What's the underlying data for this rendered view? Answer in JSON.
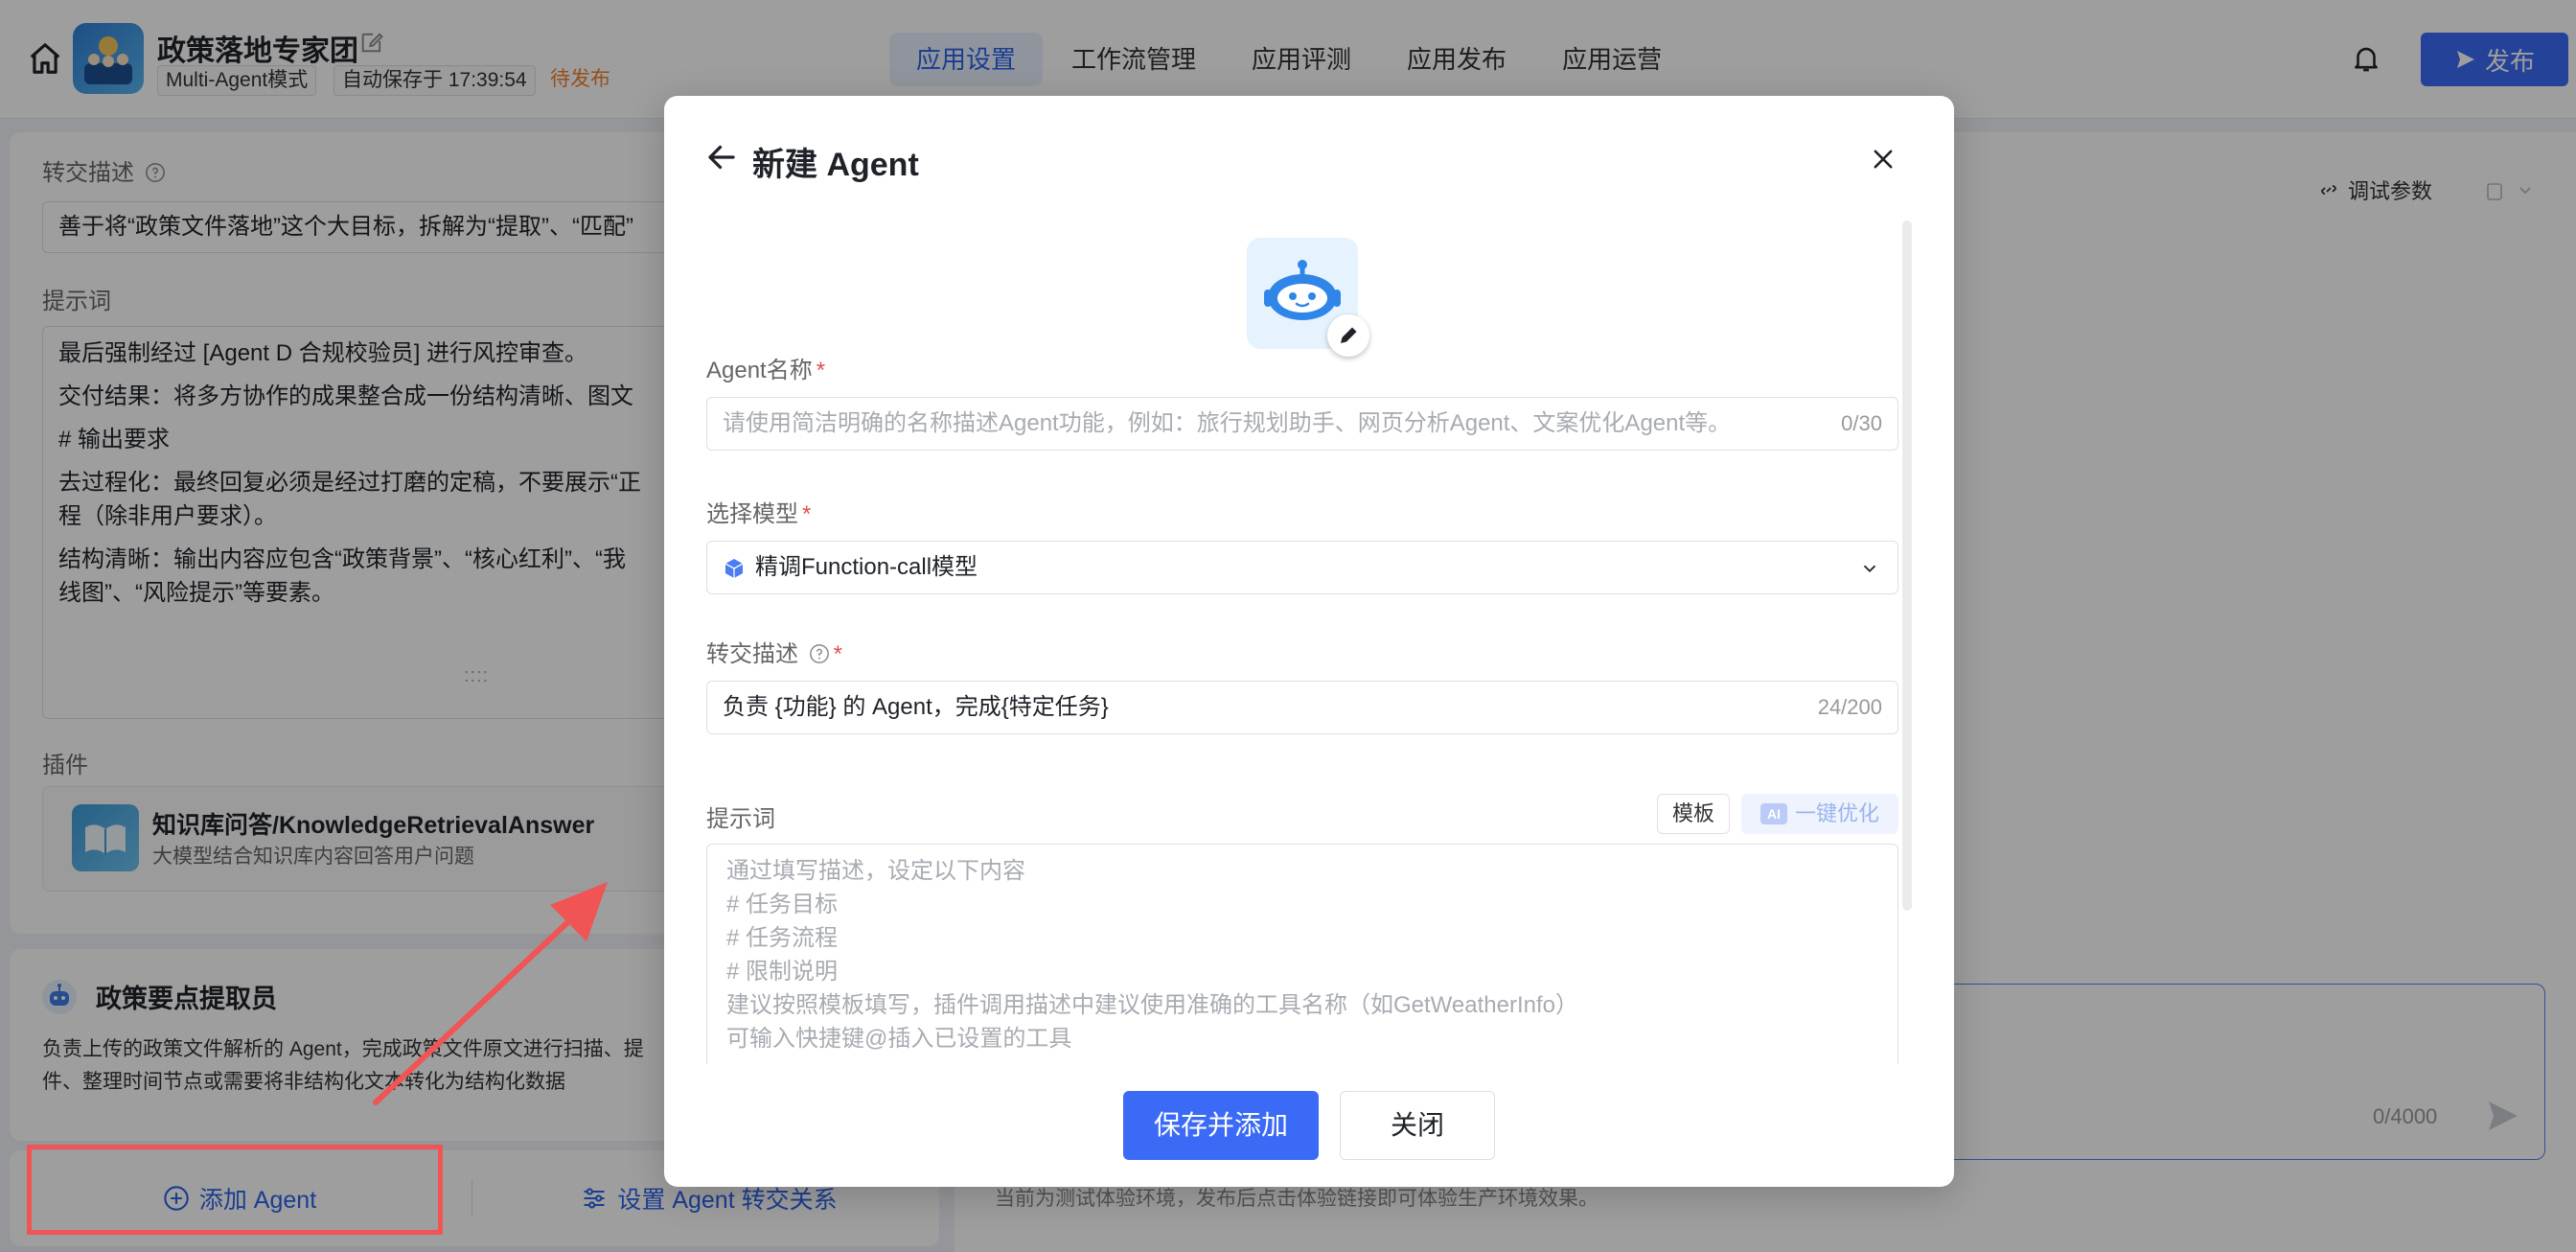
{
  "header": {
    "app_title": "政策落地专家团",
    "mode_tag": "Multi-Agent模式",
    "autosave": "自动保存于 17:39:54",
    "status": "待发布",
    "tabs": [
      {
        "label": "应用设置",
        "active": true
      },
      {
        "label": "工作流管理",
        "active": false
      },
      {
        "label": "应用评测",
        "active": false
      },
      {
        "label": "应用发布",
        "active": false
      },
      {
        "label": "应用运营",
        "active": false
      }
    ],
    "publish_label": "发布"
  },
  "left": {
    "handoff_label": "转交描述",
    "handoff_value": "善于将“政策文件落地”这个大目标，拆解为“提取”、“匹配”",
    "prompt_label": "提示词",
    "prompt_lines": [
      "最后强制经过 [Agent D 合规校验员] 进行风控审查。",
      "交付结果：将多方协作的成果整合成一份结构清晰、图文",
      "# 输出要求",
      "去过程化：最终回复必须是经过打磨的定稿，不要展示“正\n程（除非用户要求）。",
      "结构清晰：输出内容应包含“政策背景”、“核心红利”、“我\n线图”、“风险提示”等要素。"
    ],
    "resize_handle": "::::",
    "plugin_label": "插件",
    "plugin_name": "知识库问答/KnowledgeRetrievalAnswer",
    "plugin_desc": "大模型结合知识库内容回答用户问题"
  },
  "agent_card": {
    "name": "政策要点提取员",
    "desc": "负责上传的政策文件解析的 Agent，完成政策文件原文进行扫描、提\n件、整理时间节点或需要将非结构化文本转化为结构化数据"
  },
  "bottom_bar": {
    "add_agent": "添加 Agent",
    "set_handoff": "设置 Agent 转交关系"
  },
  "right": {
    "debug_params": "调试参数",
    "chat_counter": "0/4000",
    "env_note": "当前为测试体验环境，发布后点击体验链接即可体验生产环境效果。"
  },
  "modal": {
    "title": "新建 Agent",
    "name_label": "Agent名称",
    "name_placeholder": "请使用简洁明确的名称描述Agent功能，例如：旅行规划助手、网页分析Agent、文案优化Agent等。",
    "name_counter": "0/30",
    "model_label": "选择模型",
    "model_value": "精调Function-call模型",
    "handoff_label": "转交描述",
    "handoff_value": "负责 {功能} 的 Agent，完成{特定任务}",
    "handoff_counter": "24/200",
    "prompt_label": "提示词",
    "template_btn": "模板",
    "ai_badge": "AI",
    "ai_optimize_btn": "一键优化",
    "prompt_placeholder_lines": [
      "通过填写描述，设定以下内容",
      "# 任务目标",
      "# 任务流程",
      "# 限制说明",
      "建议按照模板填写，插件调用描述中建议使用准确的工具名称（如GetWeatherInfo）",
      "可输入快捷键@插入已设置的工具"
    ],
    "required_mark": "*",
    "save_btn": "保存并添加",
    "close_btn": "关闭"
  },
  "colors": {
    "primary": "#3b6bf6",
    "status_orange": "#f2802d",
    "annotation_red": "#f05454"
  }
}
